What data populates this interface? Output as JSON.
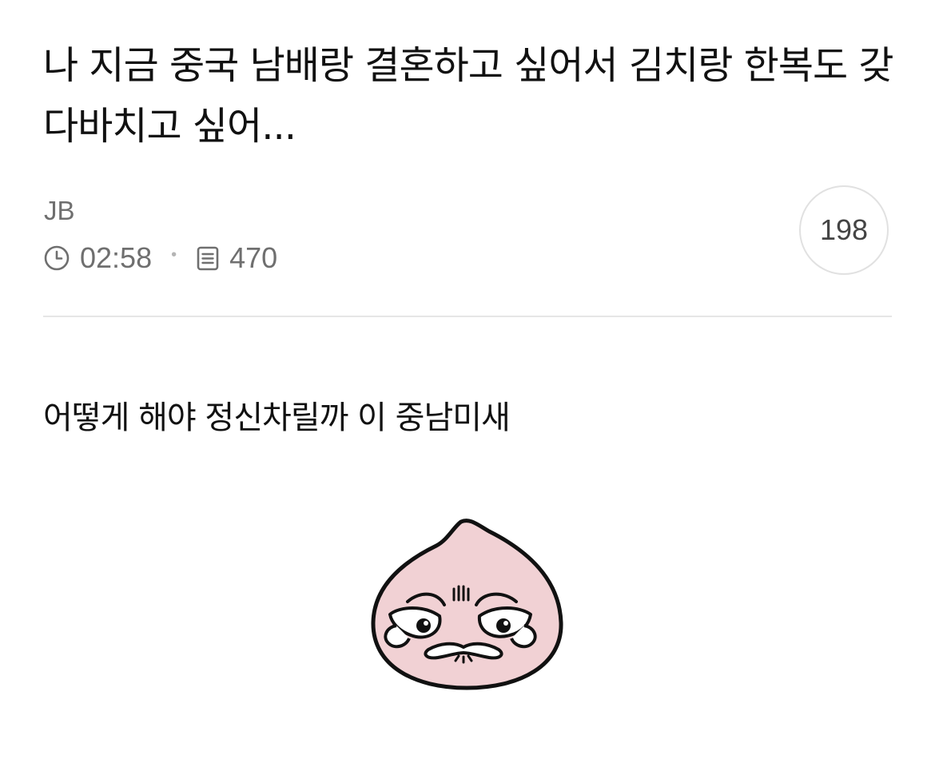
{
  "post": {
    "title": "나 지금 중국 남배랑 결혼하고 싶어서 김치랑 한복도 갖다바치고 싶어...",
    "author": "JB",
    "time": "02:58",
    "views": "470",
    "comment_count": "198",
    "body": "어떻게 해야 정신차릴까 이 중남미새"
  },
  "icons": {
    "time": "clock-icon",
    "views": "document-icon",
    "sticker": "crying-peach-sticker"
  },
  "colors": {
    "text": "#111111",
    "meta": "#6f6f6f",
    "divider": "#e6e6e6",
    "badge_border": "#e1e1e1",
    "sticker_fill": "#f1d1d4"
  }
}
